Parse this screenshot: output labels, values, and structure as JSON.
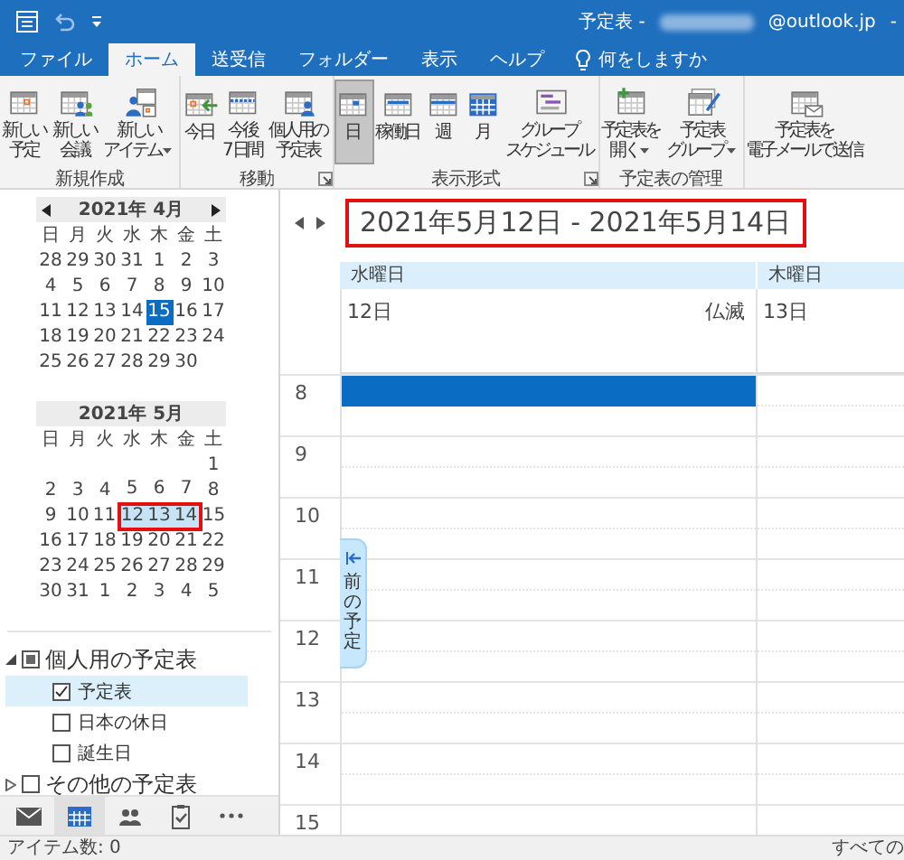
{
  "titlebar": {
    "title": "予定表 -",
    "account_redacted": true,
    "account": "@outlook.jp",
    "minimize_label": "-"
  },
  "tabs": [
    {
      "label": "ファイル",
      "selected": false
    },
    {
      "label": "ホーム",
      "selected": true
    },
    {
      "label": "送受信",
      "selected": false
    },
    {
      "label": "フォルダー",
      "selected": false
    },
    {
      "label": "表示",
      "selected": false
    },
    {
      "label": "ヘルプ",
      "selected": false
    }
  ],
  "tell_me": {
    "placeholder": "何をしますか"
  },
  "ribbon": {
    "groups": [
      {
        "label": "新規作成",
        "launcher": false,
        "buttons": [
          {
            "kind": "appointment",
            "lines": [
              "新しい",
              "予定"
            ],
            "dropdown": false,
            "selected": false
          },
          {
            "kind": "meeting",
            "lines": [
              "新しい",
              "会議"
            ],
            "dropdown": false,
            "selected": false
          },
          {
            "kind": "item",
            "lines": [
              "新しい",
              "アイテム"
            ],
            "dropdown": true,
            "selected": false
          }
        ]
      },
      {
        "label": "移動",
        "launcher": true,
        "buttons": [
          {
            "kind": "today",
            "lines": [
              "今日"
            ],
            "dropdown": false,
            "selected": false
          },
          {
            "kind": "next7",
            "lines": [
              "今後",
              "7 日間"
            ],
            "dropdown": false,
            "selected": false
          },
          {
            "kind": "personal",
            "lines": [
              "個人用の",
              "予定表"
            ],
            "dropdown": false,
            "selected": false
          }
        ]
      },
      {
        "label": "表示形式",
        "launcher": true,
        "buttons": [
          {
            "kind": "day",
            "lines": [
              "日"
            ],
            "dropdown": false,
            "selected": true
          },
          {
            "kind": "workweek",
            "lines": [
              "稼働日"
            ],
            "dropdown": false,
            "selected": false
          },
          {
            "kind": "week",
            "lines": [
              "週"
            ],
            "dropdown": false,
            "selected": false
          },
          {
            "kind": "month",
            "lines": [
              "月"
            ],
            "dropdown": false,
            "selected": false
          },
          {
            "kind": "schedule",
            "lines": [
              "グループ",
              "スケジュール"
            ],
            "dropdown": false,
            "selected": false
          }
        ]
      },
      {
        "label": "予定表の管理",
        "launcher": false,
        "buttons": [
          {
            "kind": "open",
            "lines": [
              "予定表を",
              "開く"
            ],
            "dropdown": true,
            "selected": false
          },
          {
            "kind": "groups",
            "lines": [
              "予定表",
              "グループ"
            ],
            "dropdown": true,
            "selected": false
          }
        ]
      },
      {
        "launcher": false,
        "buttons": [
          {
            "kind": "email",
            "lines": [
              "予定表を",
              "電子メールで送信"
            ],
            "dropdown": false,
            "selected": false
          }
        ]
      }
    ]
  },
  "mini_calendars": [
    {
      "title": "2021年 4月",
      "nav_arrows": true,
      "framed": false,
      "weekdays": [
        "日",
        "月",
        "火",
        "水",
        "木",
        "金",
        "土"
      ],
      "weeks": [
        [
          {
            "d": "28",
            "today": false,
            "selected": false
          },
          {
            "d": "29",
            "today": false,
            "selected": false
          },
          {
            "d": "30",
            "today": false,
            "selected": false
          },
          {
            "d": "31",
            "today": false,
            "selected": false
          },
          {
            "d": "1",
            "today": false,
            "selected": false
          },
          {
            "d": "2",
            "today": false,
            "selected": false
          },
          {
            "d": "3",
            "today": false,
            "selected": false
          }
        ],
        [
          {
            "d": "4",
            "today": false,
            "selected": false
          },
          {
            "d": "5",
            "today": false,
            "selected": false
          },
          {
            "d": "6",
            "today": false,
            "selected": false
          },
          {
            "d": "7",
            "today": false,
            "selected": false
          },
          {
            "d": "8",
            "today": false,
            "selected": false
          },
          {
            "d": "9",
            "today": false,
            "selected": false
          },
          {
            "d": "10",
            "today": false,
            "selected": false
          }
        ],
        [
          {
            "d": "11",
            "today": false,
            "selected": false
          },
          {
            "d": "12",
            "today": false,
            "selected": false
          },
          {
            "d": "13",
            "today": false,
            "selected": false
          },
          {
            "d": "14",
            "today": false,
            "selected": false
          },
          {
            "d": "15",
            "today": true,
            "selected": false
          },
          {
            "d": "16",
            "today": false,
            "selected": false
          },
          {
            "d": "17",
            "today": false,
            "selected": false
          }
        ],
        [
          {
            "d": "18",
            "today": false,
            "selected": false
          },
          {
            "d": "19",
            "today": false,
            "selected": false
          },
          {
            "d": "20",
            "today": false,
            "selected": false
          },
          {
            "d": "21",
            "today": false,
            "selected": false
          },
          {
            "d": "22",
            "today": false,
            "selected": false
          },
          {
            "d": "23",
            "today": false,
            "selected": false
          },
          {
            "d": "24",
            "today": false,
            "selected": false
          }
        ],
        [
          {
            "d": "25",
            "today": false,
            "selected": false
          },
          {
            "d": "26",
            "today": false,
            "selected": false
          },
          {
            "d": "27",
            "today": false,
            "selected": false
          },
          {
            "d": "28",
            "today": false,
            "selected": false
          },
          {
            "d": "29",
            "today": false,
            "selected": false
          },
          {
            "d": "30",
            "today": false,
            "selected": false
          }
        ]
      ]
    },
    {
      "title": "2021年 5月",
      "nav_arrows": false,
      "framed": true,
      "weekdays": [
        "日",
        "月",
        "火",
        "水",
        "木",
        "金",
        "土"
      ],
      "weeks": [
        [
          {
            "d": "1",
            "today": false,
            "selected": false
          }
        ],
        [
          {
            "d": "2",
            "today": false,
            "selected": false
          },
          {
            "d": "3",
            "today": false,
            "selected": false
          },
          {
            "d": "4",
            "today": false,
            "selected": false
          },
          {
            "d": "5",
            "today": false,
            "selected": false
          },
          {
            "d": "6",
            "today": false,
            "selected": false
          },
          {
            "d": "7",
            "today": false,
            "selected": false
          },
          {
            "d": "8",
            "today": false,
            "selected": false
          }
        ],
        [
          {
            "d": "9",
            "today": false,
            "selected": false
          },
          {
            "d": "10",
            "today": false,
            "selected": false
          },
          {
            "d": "11",
            "today": false,
            "selected": false
          },
          {
            "d": "12",
            "today": false,
            "selected": true
          },
          {
            "d": "13",
            "today": false,
            "selected": true
          },
          {
            "d": "14",
            "today": false,
            "selected": true
          },
          {
            "d": "15",
            "today": false,
            "selected": false
          }
        ],
        [
          {
            "d": "16",
            "today": false,
            "selected": false
          },
          {
            "d": "17",
            "today": false,
            "selected": false
          },
          {
            "d": "18",
            "today": false,
            "selected": false
          },
          {
            "d": "19",
            "today": false,
            "selected": false
          },
          {
            "d": "20",
            "today": false,
            "selected": false
          },
          {
            "d": "21",
            "today": false,
            "selected": false
          },
          {
            "d": "22",
            "today": false,
            "selected": false
          }
        ],
        [
          {
            "d": "23",
            "today": false,
            "selected": false
          },
          {
            "d": "24",
            "today": false,
            "selected": false
          },
          {
            "d": "25",
            "today": false,
            "selected": false
          },
          {
            "d": "26",
            "today": false,
            "selected": false
          },
          {
            "d": "27",
            "today": false,
            "selected": false
          },
          {
            "d": "28",
            "today": false,
            "selected": false
          },
          {
            "d": "29",
            "today": false,
            "selected": false
          }
        ],
        [
          {
            "d": "30",
            "today": false,
            "selected": false
          },
          {
            "d": "31",
            "today": false,
            "selected": false
          },
          {
            "d": "1",
            "today": false,
            "selected": false
          },
          {
            "d": "2",
            "today": false,
            "selected": false
          },
          {
            "d": "3",
            "today": false,
            "selected": false
          },
          {
            "d": "4",
            "today": false,
            "selected": false
          },
          {
            "d": "5",
            "today": false,
            "selected": false
          }
        ]
      ]
    }
  ],
  "calendar_groups": [
    {
      "label": "個人用の予定表",
      "expanded": true,
      "checked": false,
      "partial": true,
      "children": [
        {
          "label": "予定表",
          "checked": true,
          "selected": true
        },
        {
          "label": "日本の休日",
          "checked": false,
          "selected": false
        },
        {
          "label": "誕生日",
          "checked": false,
          "selected": false
        }
      ]
    },
    {
      "label": "その他の予定表",
      "expanded": false,
      "checked": false,
      "partial": false
    }
  ],
  "nav_bar": [
    {
      "kind": "mail",
      "selected": false
    },
    {
      "kind": "calendar",
      "selected": true
    },
    {
      "kind": "people",
      "selected": false
    },
    {
      "kind": "tasks",
      "selected": false
    },
    {
      "kind": "more",
      "selected": false
    }
  ],
  "calendar_view": {
    "date_range": "2021年5月12日 - 2021年5月14日",
    "framed": true,
    "days": [
      {
        "weekday": "水曜日",
        "date": "12日",
        "rokuyo": "仏滅"
      },
      {
        "weekday": "木曜日",
        "date": "13日"
      }
    ],
    "time_slots": [
      {
        "label": "8",
        "selected": true
      },
      {
        "label": "9",
        "selected": false
      },
      {
        "label": "10",
        "selected": false
      },
      {
        "label": "11",
        "selected": false
      },
      {
        "label": "12",
        "selected": false
      },
      {
        "label": "13",
        "selected": false
      },
      {
        "label": "14",
        "selected": false
      },
      {
        "label": "15",
        "selected": false
      }
    ],
    "side_tab": {
      "label": "前の予定"
    }
  },
  "status_bar": {
    "left": "アイテム数: 0",
    "right": "すべての"
  }
}
